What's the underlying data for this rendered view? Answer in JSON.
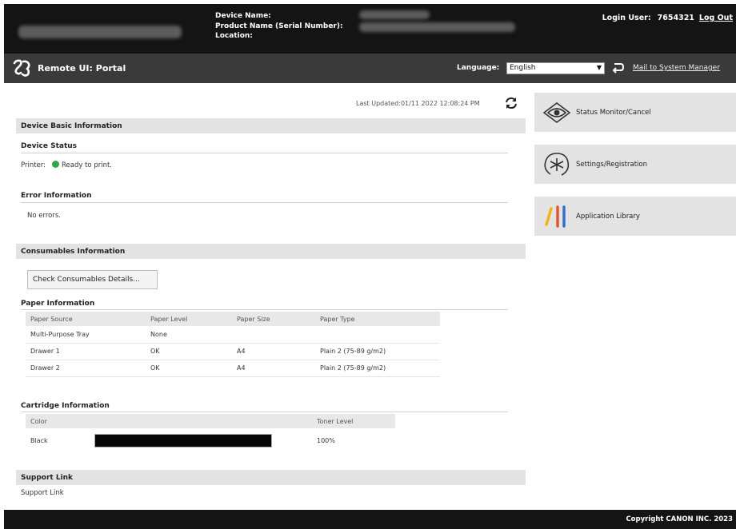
{
  "header": {
    "device_name_label": "Device Name:",
    "product_name_label": "Product Name (Serial Number):",
    "location_label": "Location:",
    "login_user_label": "Login User:",
    "login_user_id": "7654321",
    "logout_label": "Log Out"
  },
  "titlebar": {
    "title": "Remote UI: Portal",
    "language_label": "Language:",
    "language_value": "English",
    "mail_link": "Mail to System Manager"
  },
  "main": {
    "last_updated": "Last Updated:01/11 2022 12:08:24 PM",
    "device_basic": {
      "title": "Device Basic Information",
      "device_status_title": "Device Status",
      "printer_label": "Printer:",
      "printer_status": "Ready to print.",
      "status_color": "#2ea84a",
      "error_title": "Error Information",
      "error_text": "No errors."
    },
    "consumables": {
      "title": "Consumables Information",
      "check_button": "Check Consumables Details...",
      "paper": {
        "title": "Paper Information",
        "columns": [
          "Paper Source",
          "Paper Level",
          "Paper Size",
          "Paper Type"
        ],
        "rows": [
          [
            "Multi-Purpose Tray",
            "None",
            "",
            ""
          ],
          [
            "Drawer 1",
            "OK",
            "A4",
            "Plain 2 (75-89 g/m2)"
          ],
          [
            "Drawer 2",
            "OK",
            "A4",
            "Plain 2 (75-89 g/m2)"
          ]
        ]
      },
      "cartridge": {
        "title": "Cartridge Information",
        "columns": [
          "Color",
          "",
          "Toner Level"
        ],
        "rows": [
          {
            "color": "Black",
            "level_text": "100%",
            "level_fraction": 1.0
          }
        ]
      }
    },
    "support": {
      "title": "Support Link",
      "link_text": "Support Link"
    }
  },
  "right_panel": {
    "items": [
      {
        "label": "Status Monitor/Cancel",
        "icon": "eye-icon"
      },
      {
        "label": "Settings/Registration",
        "icon": "settings-icon"
      },
      {
        "label": "Application Library",
        "icon": "library-icon"
      }
    ]
  },
  "footer": {
    "copyright": "Copyright CANON INC. 2023"
  }
}
